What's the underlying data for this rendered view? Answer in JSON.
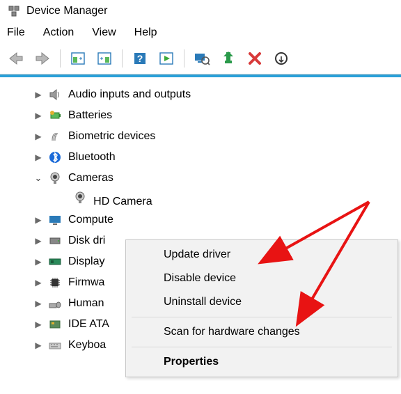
{
  "window": {
    "title": "Device Manager"
  },
  "menu": {
    "items": [
      "File",
      "Action",
      "View",
      "Help"
    ]
  },
  "toolbar_icons": [
    "back",
    "forward",
    "panel-left",
    "panel-right",
    "help",
    "play-panel",
    "monitor-search",
    "update-badge",
    "delete",
    "scan"
  ],
  "tree": {
    "items": [
      {
        "label": "Audio inputs and outputs",
        "icon": "speaker",
        "expanded": false
      },
      {
        "label": "Batteries",
        "icon": "battery",
        "expanded": false
      },
      {
        "label": "Biometric devices",
        "icon": "fingerprint",
        "expanded": false
      },
      {
        "label": "Bluetooth",
        "icon": "bluetooth",
        "expanded": false
      },
      {
        "label": "Cameras",
        "icon": "camera",
        "expanded": true,
        "children": [
          {
            "label": "HD Camera",
            "icon": "camera",
            "selected": true
          }
        ]
      },
      {
        "label": "Compute",
        "truncated": "Compute",
        "icon": "monitor",
        "expanded": false
      },
      {
        "label": "Disk dri",
        "icon": "disk",
        "expanded": false
      },
      {
        "label": "Display",
        "icon": "gpu",
        "expanded": false
      },
      {
        "label": "Firmwa",
        "icon": "chip",
        "expanded": false
      },
      {
        "label": "Human",
        "icon": "hid",
        "expanded": false
      },
      {
        "label": "IDE ATA",
        "icon": "ide",
        "expanded": false
      },
      {
        "label": "Keyboa",
        "icon": "keyboard",
        "expanded": false
      }
    ]
  },
  "context_menu": {
    "items": [
      {
        "label": "Update driver"
      },
      {
        "label": "Disable device"
      },
      {
        "label": "Uninstall device"
      },
      {
        "sep": true
      },
      {
        "label": "Scan for hardware changes"
      },
      {
        "sep": true
      },
      {
        "label": "Properties",
        "bold": true
      }
    ]
  }
}
